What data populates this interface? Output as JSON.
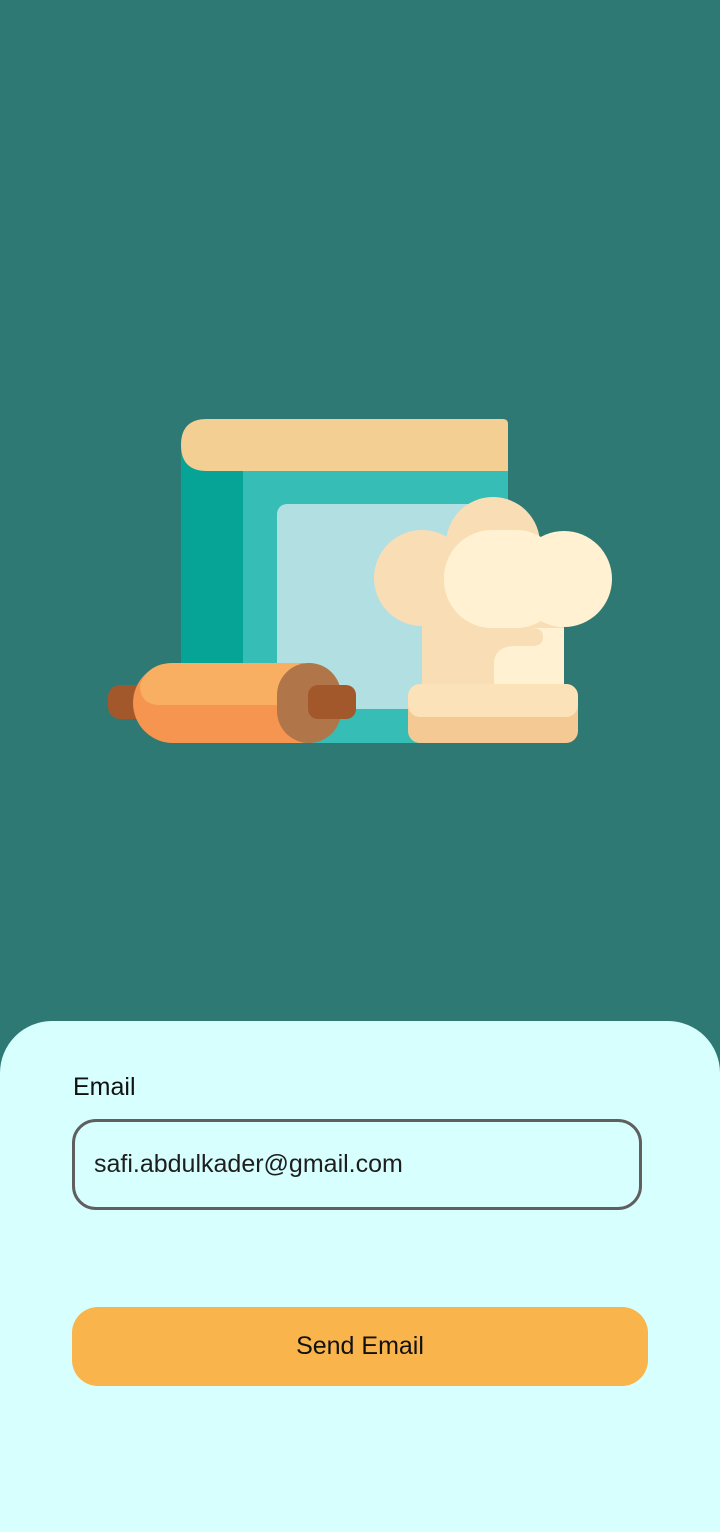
{
  "theme": {
    "background": "#2e7973",
    "sheet_background": "#d6fffe",
    "accent": "#f9b44b",
    "field_border": "#5f5f5f"
  },
  "illustration": {
    "icon": "cookbook-chef-hat-rolling-pin-illustration"
  },
  "form": {
    "email_label": "Email",
    "email_value": "safi.abdulkader@gmail.com",
    "send_button_label": "Send Email"
  }
}
